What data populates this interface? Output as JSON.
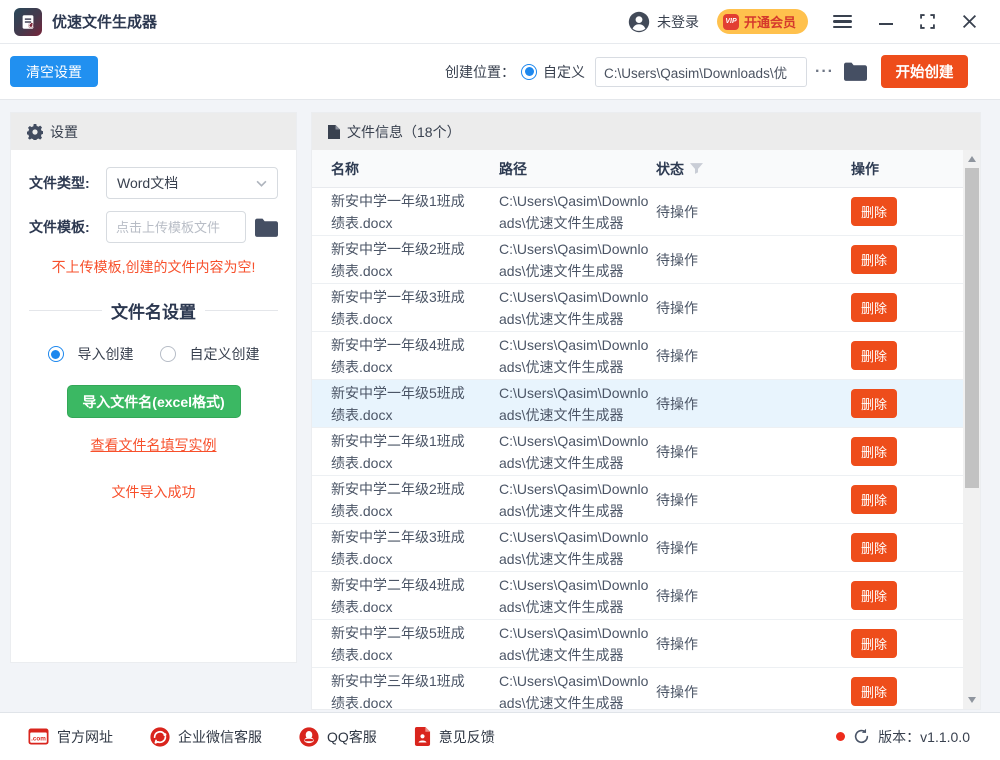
{
  "titlebar": {
    "app_title": "优速文件生成器",
    "login_status": "未登录",
    "vip_badge": "VIP",
    "vip_button": "开通会员"
  },
  "toolbar": {
    "clear_button": "清空设置",
    "location_label": "创建位置：",
    "location_radio": "自定义",
    "path_value": "C:\\Users\\Qasim\\Downloads\\优",
    "more_button": "···",
    "start_button": "开始创建"
  },
  "settings_panel": {
    "header": "设置",
    "file_type_label": "文件类型:",
    "file_type_value": "Word文档",
    "template_label": "文件模板:",
    "template_placeholder": "点击上传模板文件",
    "warning": "不上传模板,创建的文件内容为空!",
    "filename_heading": "文件名设置",
    "radio_import": "导入创建",
    "radio_custom": "自定义创建",
    "import_button": "导入文件名(excel格式)",
    "example_link": "查看文件名填写实例",
    "import_status": "文件导入成功"
  },
  "file_panel": {
    "header": "文件信息（18个）",
    "columns": [
      "名称",
      "路径",
      "状态",
      "操作"
    ],
    "delete_label": "删除",
    "rows": [
      {
        "name": "新安中学一年级1班成绩表.docx",
        "path": "C:\\Users\\Qasim\\Downloads\\优速文件生成器",
        "status": "待操作",
        "highlighted": false
      },
      {
        "name": "新安中学一年级2班成绩表.docx",
        "path": "C:\\Users\\Qasim\\Downloads\\优速文件生成器",
        "status": "待操作",
        "highlighted": false
      },
      {
        "name": "新安中学一年级3班成绩表.docx",
        "path": "C:\\Users\\Qasim\\Downloads\\优速文件生成器",
        "status": "待操作",
        "highlighted": false
      },
      {
        "name": "新安中学一年级4班成绩表.docx",
        "path": "C:\\Users\\Qasim\\Downloads\\优速文件生成器",
        "status": "待操作",
        "highlighted": false
      },
      {
        "name": "新安中学一年级5班成绩表.docx",
        "path": "C:\\Users\\Qasim\\Downloads\\优速文件生成器",
        "status": "待操作",
        "highlighted": true
      },
      {
        "name": "新安中学二年级1班成绩表.docx",
        "path": "C:\\Users\\Qasim\\Downloads\\优速文件生成器",
        "status": "待操作",
        "highlighted": false
      },
      {
        "name": "新安中学二年级2班成绩表.docx",
        "path": "C:\\Users\\Qasim\\Downloads\\优速文件生成器",
        "status": "待操作",
        "highlighted": false
      },
      {
        "name": "新安中学二年级3班成绩表.docx",
        "path": "C:\\Users\\Qasim\\Downloads\\优速文件生成器",
        "status": "待操作",
        "highlighted": false
      },
      {
        "name": "新安中学二年级4班成绩表.docx",
        "path": "C:\\Users\\Qasim\\Downloads\\优速文件生成器",
        "status": "待操作",
        "highlighted": false
      },
      {
        "name": "新安中学二年级5班成绩表.docx",
        "path": "C:\\Users\\Qasim\\Downloads\\优速文件生成器",
        "status": "待操作",
        "highlighted": false
      },
      {
        "name": "新安中学三年级1班成绩表.docx",
        "path": "C:\\Users\\Qasim\\Downloads\\优速文件生成器",
        "status": "待操作",
        "highlighted": false
      }
    ]
  },
  "footer": {
    "links": [
      "官方网址",
      "企业微信客服",
      "QQ客服",
      "意见反馈"
    ],
    "version_text": "版本：v1.1.0.0"
  },
  "colors": {
    "accent_blue": "#2190f0",
    "accent_orange_red": "#ee4d1b",
    "accent_green": "#3bb863",
    "warning_red": "#f7502c",
    "vip_yellow": "#ffc14d",
    "footer_icon_red": "#d9251d",
    "row_highlight": "#e8f4fd"
  }
}
